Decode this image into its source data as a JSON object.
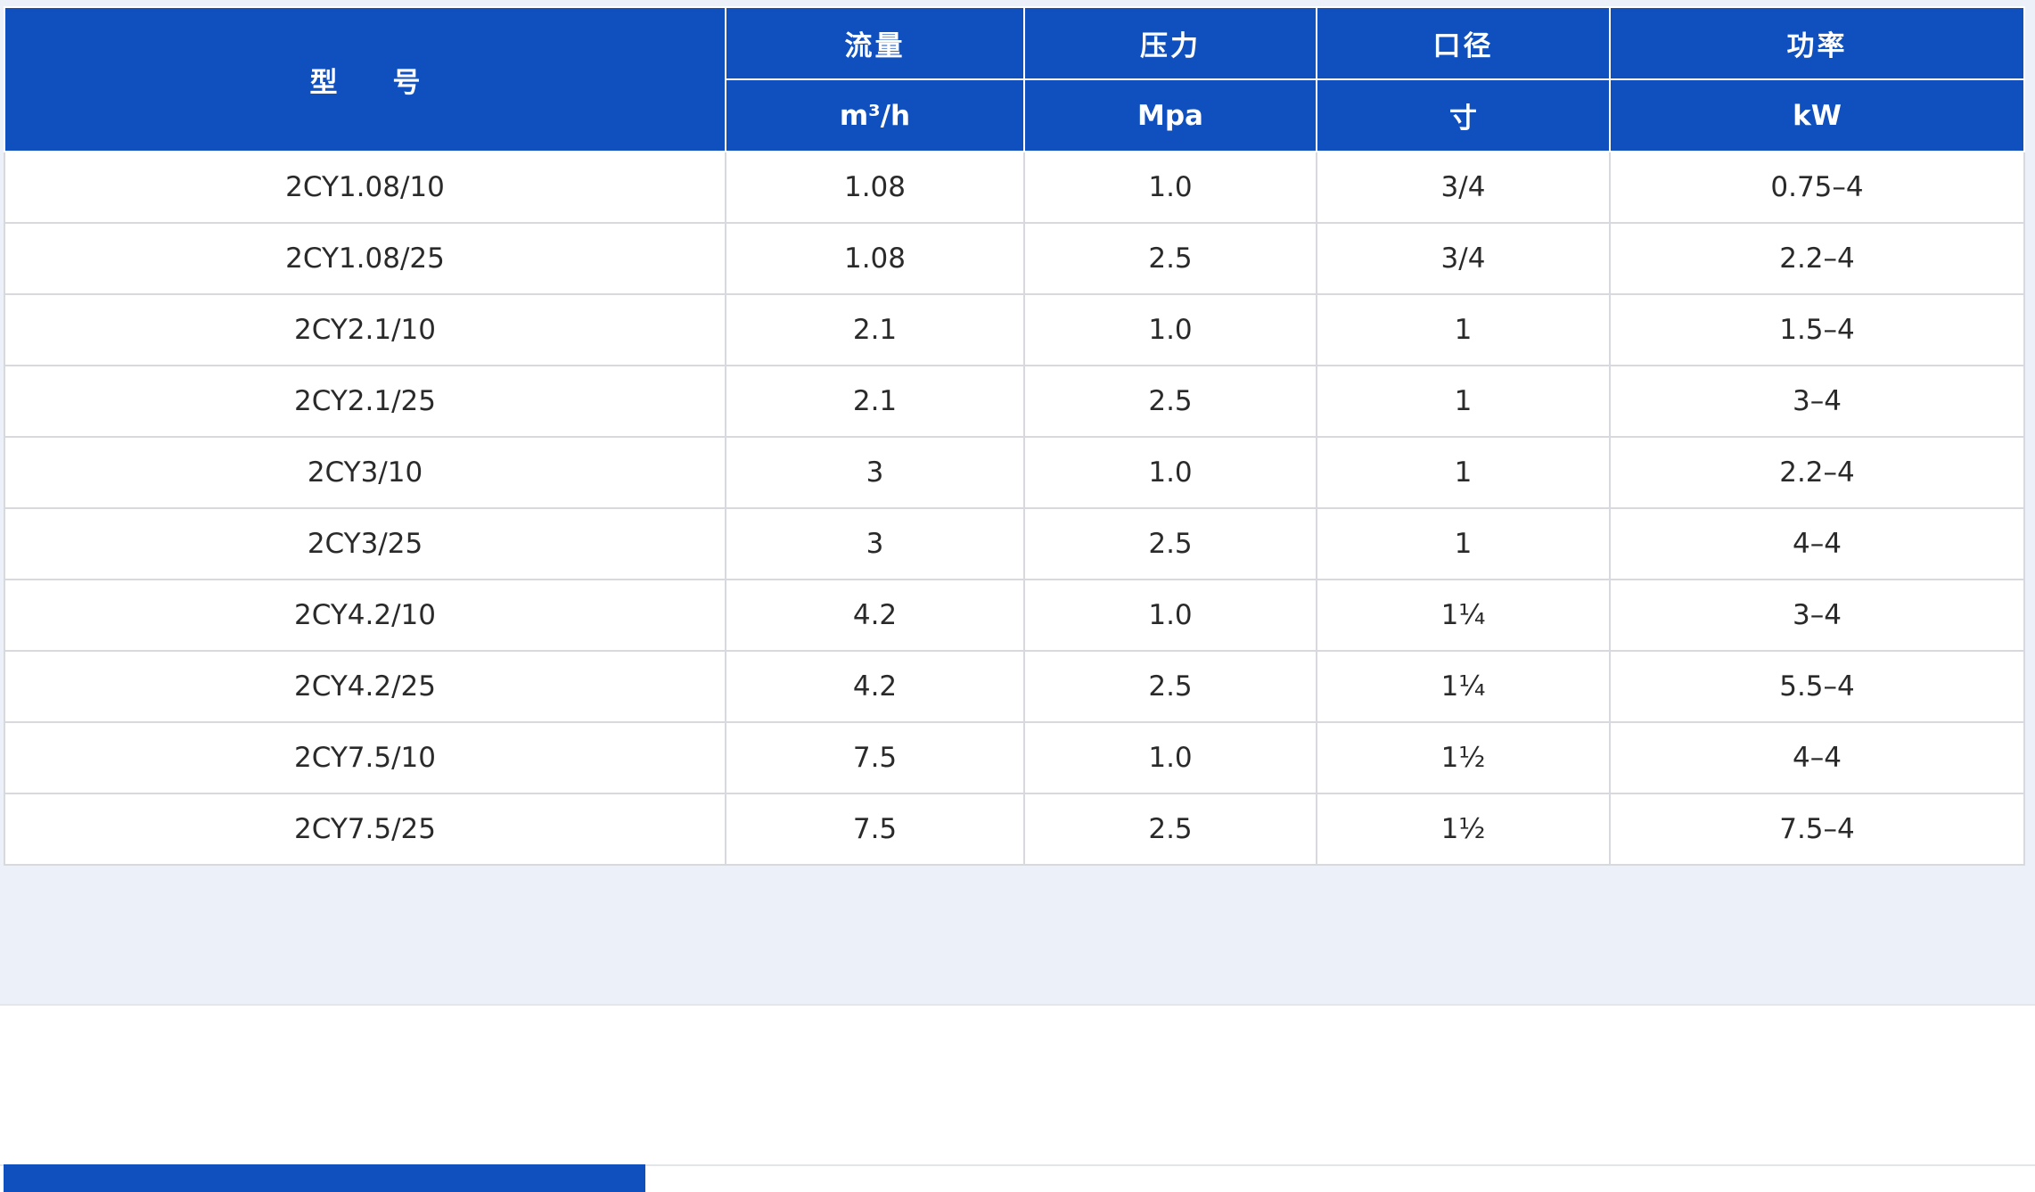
{
  "table": {
    "headers": {
      "model": [
        "型",
        "号"
      ],
      "flow": "流量",
      "pressure": "压力",
      "caliber": "口径",
      "power": "功率"
    },
    "units": {
      "flow": "m³/h",
      "pressure": "Mpa",
      "caliber": "寸",
      "power": "kW"
    },
    "rows": [
      {
        "model": "2CY1.08/10",
        "flow": "1.08",
        "pressure": "1.0",
        "caliber": "3/4",
        "power": "0.75–4"
      },
      {
        "model": "2CY1.08/25",
        "flow": "1.08",
        "pressure": "2.5",
        "caliber": "3/4",
        "power": "2.2–4"
      },
      {
        "model": "2CY2.1/10",
        "flow": "2.1",
        "pressure": "1.0",
        "caliber": "1",
        "power": "1.5–4"
      },
      {
        "model": "2CY2.1/25",
        "flow": "2.1",
        "pressure": "2.5",
        "caliber": "1",
        "power": "3–4"
      },
      {
        "model": "2CY3/10",
        "flow": "3",
        "pressure": "1.0",
        "caliber": "1",
        "power": "2.2–4"
      },
      {
        "model": "2CY3/25",
        "flow": "3",
        "pressure": "2.5",
        "caliber": "1",
        "power": "4–4"
      },
      {
        "model": "2CY4.2/10",
        "flow": "4.2",
        "pressure": "1.0",
        "caliber": "1¼",
        "power": "3–4"
      },
      {
        "model": "2CY4.2/25",
        "flow": "4.2",
        "pressure": "2.5",
        "caliber": "1¼",
        "power": "5.5–4"
      },
      {
        "model": "2CY7.5/10",
        "flow": "7.5",
        "pressure": "1.0",
        "caliber": "1½",
        "power": "4–4"
      },
      {
        "model": "2CY7.5/25",
        "flow": "7.5",
        "pressure": "2.5",
        "caliber": "1½",
        "power": "7.5–4"
      }
    ]
  },
  "colors": {
    "header_bg": "#0f50be",
    "header_text": "#ffffff",
    "panel_bg": "#ecf0f9",
    "accent_red": "#e0101a"
  }
}
